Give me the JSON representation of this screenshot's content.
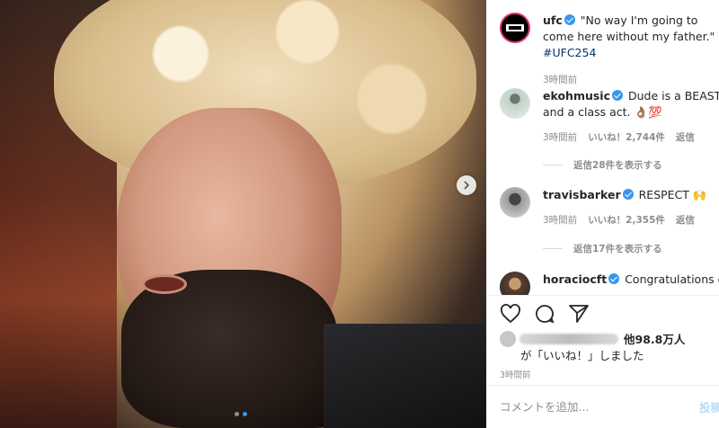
{
  "colors": {
    "accent": "#3897f0",
    "hashtag": "#003569",
    "muted": "#8e8e8e",
    "post_disabled": "#b2dffc"
  },
  "photo": {
    "icon": "chevron-right-icon",
    "slides_total": 2,
    "slide_active": 2
  },
  "caption": {
    "username": "ufc",
    "text": "\"No way I'm going to come here without my father.\"",
    "hashtag": "#UFC254",
    "time": "3時間前"
  },
  "comments": [
    {
      "username": "ekohmusic",
      "text": "Dude is a BEAST and a class act. 👌🏽💯",
      "time": "3時間前",
      "likes": "いいね！2,744件",
      "reply": "返信",
      "replies_label": "返信28件を表示する"
    },
    {
      "username": "travisbarker",
      "text": "RESPECT 🙌",
      "time": "3時間前",
      "likes": "いいね！2,355件",
      "reply": "返信",
      "replies_label": "返信17件を表示する"
    },
    {
      "username": "horaciocft",
      "text": "Congratulations on"
    }
  ],
  "actions": {
    "icons": [
      "heart-icon",
      "comment-icon",
      "share-icon"
    ]
  },
  "liked_by": {
    "count": "他98.8万人",
    "line2": "が「いいね！」しました"
  },
  "post_time": "3時間前",
  "add_comment": {
    "placeholder": "コメントを追加...",
    "post_label": "投稿"
  }
}
